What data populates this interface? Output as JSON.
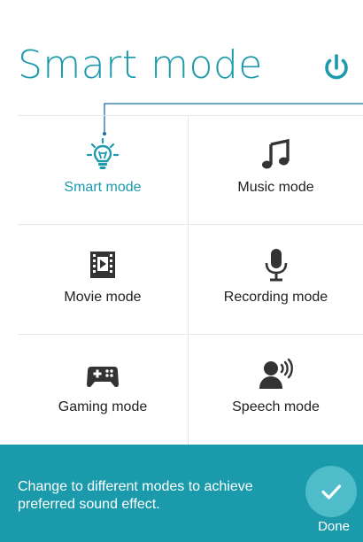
{
  "header": {
    "title": "Smart mode"
  },
  "colors": {
    "accent": "#1b9aab",
    "footer_bg": "#1b9aab",
    "done_button_bg": "#4fbcc9",
    "label_default": "#222222"
  },
  "modes": [
    {
      "label": "Smart mode",
      "icon": "lightbulb-icon",
      "selected": true
    },
    {
      "label": "Music mode",
      "icon": "music-note-icon",
      "selected": false
    },
    {
      "label": "Movie mode",
      "icon": "film-icon",
      "selected": false
    },
    {
      "label": "Recording mode",
      "icon": "microphone-icon",
      "selected": false
    },
    {
      "label": "Gaming mode",
      "icon": "gamepad-icon",
      "selected": false
    },
    {
      "label": "Speech mode",
      "icon": "speaking-person-icon",
      "selected": false
    }
  ],
  "footer": {
    "hint": "Change to different modes to achieve preferred sound effect.",
    "done_label": "Done"
  }
}
